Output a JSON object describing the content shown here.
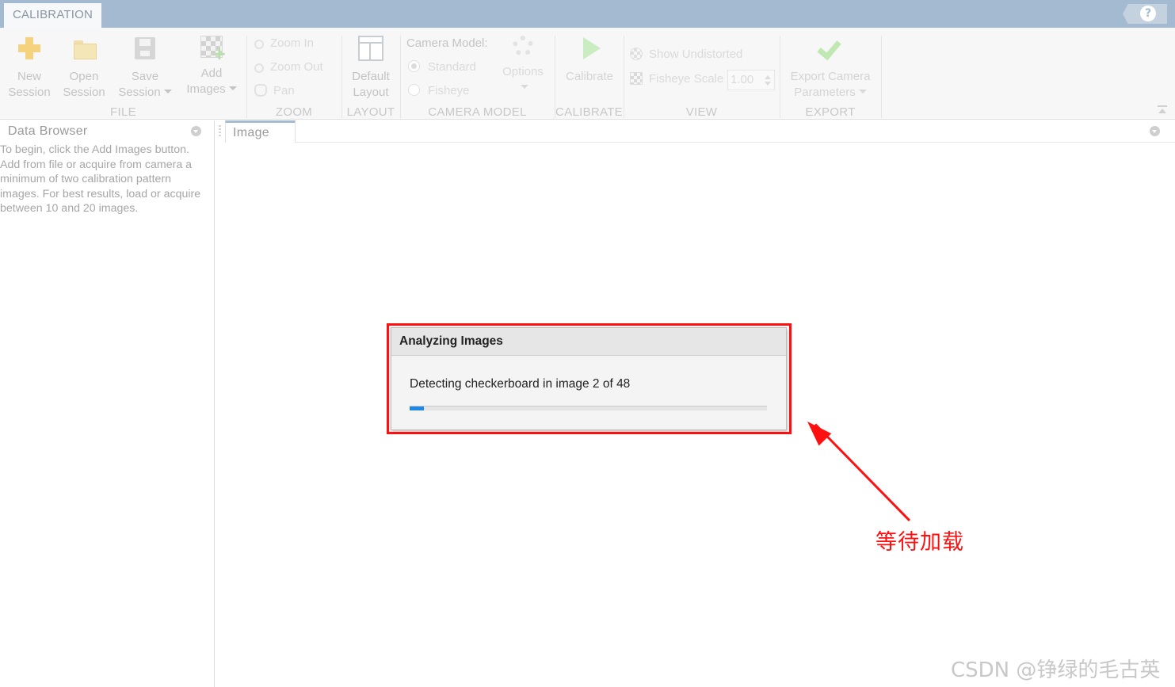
{
  "tabs": {
    "active": "CALIBRATION",
    "help": "?"
  },
  "toolstrip": {
    "file": {
      "group_label": "FILE",
      "new_session": [
        "New",
        "Session"
      ],
      "open_session": [
        "Open",
        "Session"
      ],
      "save_session": [
        "Save",
        "Session"
      ],
      "add_images": [
        "Add",
        "Images"
      ]
    },
    "zoom": {
      "group_label": "ZOOM",
      "zoom_in": "Zoom In",
      "zoom_out": "Zoom Out",
      "pan": "Pan"
    },
    "layout": {
      "group_label": "LAYOUT",
      "default_layout": [
        "Default",
        "Layout"
      ]
    },
    "camera_model": {
      "group_label": "CAMERA MODEL",
      "label": "Camera Model:",
      "standard": "Standard",
      "fisheye": "Fisheye",
      "options": "Options",
      "selected": "Standard"
    },
    "calibrate": {
      "group_label": "CALIBRATE",
      "calibrate_button": "Calibrate"
    },
    "view": {
      "group_label": "VIEW",
      "show_undistorted": "Show Undistorted",
      "fisheye_scale": "Fisheye Scale",
      "fisheye_scale_value": "1.00"
    },
    "export": {
      "group_label": "EXPORT",
      "export_camera_parameters": [
        "Export Camera",
        "Parameters"
      ]
    }
  },
  "data_browser": {
    "title": "Data Browser",
    "lines": [
      "To begin, click the Add Images button.",
      "Add from file or acquire from camera a",
      "minimum of two calibration pattern",
      "images. For best results, load or acquire",
      "between 10 and 20 images."
    ]
  },
  "image_panel": {
    "tab": "Image"
  },
  "progress_dialog": {
    "title": "Analyzing Images",
    "message": "Detecting checkerboard in image 2 of 48",
    "progress_fraction": 0.04
  },
  "annotation": {
    "text": "等待加载"
  },
  "watermark": "CSDN @铮绿的毛古英",
  "colors": {
    "accent": "#a4bad0",
    "progress": "#1e88e5",
    "annotation": "#ff1010"
  }
}
